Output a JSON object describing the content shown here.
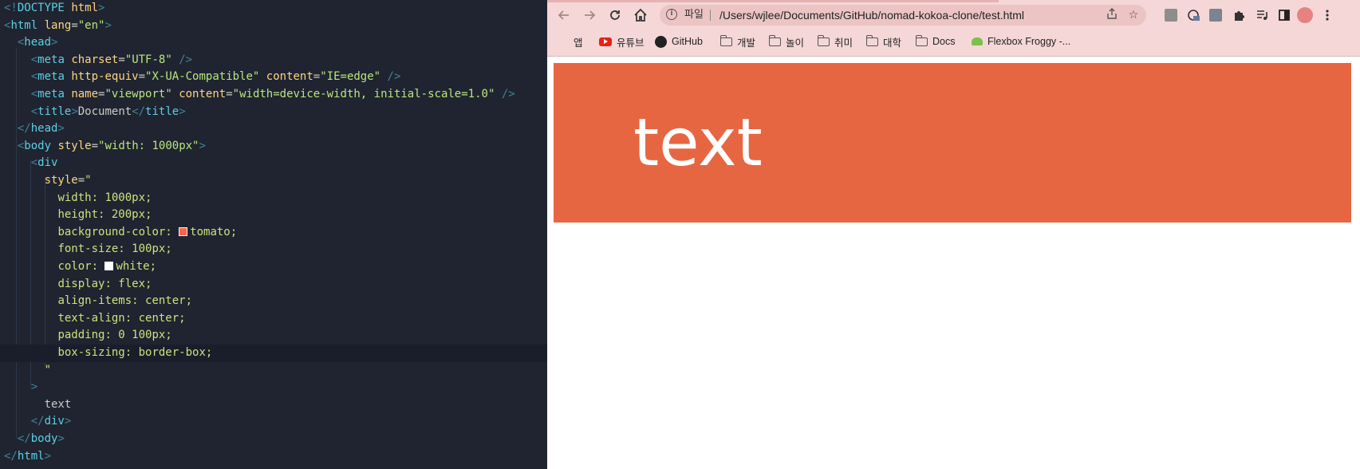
{
  "editor": {
    "lines": [
      [
        [
          "punc",
          "<!"
        ],
        [
          "doctype",
          "DOCTYPE"
        ],
        [
          "txt",
          " "
        ],
        [
          "attr",
          "html"
        ],
        [
          "punc",
          ">"
        ]
      ],
      [
        [
          "punc",
          "<"
        ],
        [
          "tag",
          "html"
        ],
        [
          "txt",
          " "
        ],
        [
          "attr",
          "lang"
        ],
        [
          "txt",
          "="
        ],
        [
          "str",
          "\"en\""
        ],
        [
          "punc",
          ">"
        ]
      ],
      [
        [
          "txt",
          "  "
        ],
        [
          "punc",
          "<"
        ],
        [
          "tag",
          "head"
        ],
        [
          "punc",
          ">"
        ]
      ],
      [
        [
          "txt",
          "    "
        ],
        [
          "punc",
          "<"
        ],
        [
          "tag",
          "meta"
        ],
        [
          "txt",
          " "
        ],
        [
          "attr",
          "charset"
        ],
        [
          "txt",
          "="
        ],
        [
          "str",
          "\"UTF-8\""
        ],
        [
          "txt",
          " "
        ],
        [
          "punc",
          "/>"
        ]
      ],
      [
        [
          "txt",
          "    "
        ],
        [
          "punc",
          "<"
        ],
        [
          "tag",
          "meta"
        ],
        [
          "txt",
          " "
        ],
        [
          "attr",
          "http-equiv"
        ],
        [
          "txt",
          "="
        ],
        [
          "str",
          "\"X-UA-Compatible\""
        ],
        [
          "txt",
          " "
        ],
        [
          "attr",
          "content"
        ],
        [
          "txt",
          "="
        ],
        [
          "str",
          "\"IE=edge\""
        ],
        [
          "txt",
          " "
        ],
        [
          "punc",
          "/>"
        ]
      ],
      [
        [
          "txt",
          "    "
        ],
        [
          "punc",
          "<"
        ],
        [
          "tag",
          "meta"
        ],
        [
          "txt",
          " "
        ],
        [
          "attr",
          "name"
        ],
        [
          "txt",
          "="
        ],
        [
          "str",
          "\"viewport\""
        ],
        [
          "txt",
          " "
        ],
        [
          "attr",
          "content"
        ],
        [
          "txt",
          "="
        ],
        [
          "str",
          "\"width=device-width, initial-scale=1.0\""
        ],
        [
          "txt",
          " "
        ],
        [
          "punc",
          "/>"
        ]
      ],
      [
        [
          "txt",
          "    "
        ],
        [
          "punc",
          "<"
        ],
        [
          "tag",
          "title"
        ],
        [
          "punc",
          ">"
        ],
        [
          "txt",
          "Document"
        ],
        [
          "punc",
          "</"
        ],
        [
          "tag",
          "title"
        ],
        [
          "punc",
          ">"
        ]
      ],
      [
        [
          "txt",
          "  "
        ],
        [
          "punc",
          "</"
        ],
        [
          "tag",
          "head"
        ],
        [
          "punc",
          ">"
        ]
      ],
      [
        [
          "txt",
          "  "
        ],
        [
          "punc",
          "<"
        ],
        [
          "tag",
          "body"
        ],
        [
          "txt",
          " "
        ],
        [
          "attr",
          "style"
        ],
        [
          "txt",
          "="
        ],
        [
          "str",
          "\"width: 1000px\""
        ],
        [
          "punc",
          ">"
        ]
      ],
      [
        [
          "txt",
          "    "
        ],
        [
          "punc",
          "<"
        ],
        [
          "tag",
          "div"
        ]
      ],
      [
        [
          "txt",
          "      "
        ],
        [
          "attr",
          "style"
        ],
        [
          "txt",
          "="
        ],
        [
          "str",
          "\""
        ]
      ],
      [
        [
          "txt",
          "        "
        ],
        [
          "css",
          "width: 1000px;"
        ]
      ],
      [
        [
          "txt",
          "        "
        ],
        [
          "css",
          "height: 200px;"
        ]
      ],
      [
        [
          "txt",
          "        "
        ],
        [
          "css",
          "background-color: "
        ],
        [
          "swatch",
          "#ff6347"
        ],
        [
          "css",
          "tomato;"
        ]
      ],
      [
        [
          "txt",
          "        "
        ],
        [
          "css",
          "font-size: 100px;"
        ]
      ],
      [
        [
          "txt",
          "        "
        ],
        [
          "css",
          "color: "
        ],
        [
          "swatch",
          "#ffffff"
        ],
        [
          "css",
          "white;"
        ]
      ],
      [
        [
          "txt",
          "        "
        ],
        [
          "css",
          "display: flex;"
        ]
      ],
      [
        [
          "txt",
          "        "
        ],
        [
          "css",
          "align-items: center;"
        ]
      ],
      [
        [
          "txt",
          "        "
        ],
        [
          "css",
          "text-align: center;"
        ]
      ],
      [
        [
          "txt",
          "        "
        ],
        [
          "css",
          "padding: 0 100px;"
        ]
      ],
      [
        [
          "txt",
          "        "
        ],
        [
          "css",
          "box-sizing: border-box;"
        ]
      ],
      [
        [
          "txt",
          "      "
        ],
        [
          "str",
          "\""
        ]
      ],
      [
        [
          "txt",
          "    "
        ],
        [
          "punc",
          ">"
        ]
      ],
      [
        [
          "txt",
          "      "
        ],
        [
          "txt",
          "text"
        ]
      ],
      [
        [
          "txt",
          "    "
        ],
        [
          "punc",
          "</"
        ],
        [
          "tag",
          "div"
        ],
        [
          "punc",
          ">"
        ]
      ],
      [
        [
          "txt",
          "  "
        ],
        [
          "punc",
          "</"
        ],
        [
          "tag",
          "body"
        ],
        [
          "punc",
          ">"
        ]
      ],
      [
        [
          "punc",
          "</"
        ],
        [
          "tag",
          "html"
        ],
        [
          "punc",
          ">"
        ]
      ]
    ],
    "active_line": 20
  },
  "browser": {
    "back_icon": "arrow-left-icon",
    "forward_icon": "arrow-right-icon",
    "reload_icon": "reload-icon",
    "home_icon": "home-icon",
    "address_scheme": "파일",
    "address_url": "/Users/wjlee/Documents/GitHub/nomad-kokoa-clone/test.html",
    "bookmarks": [
      {
        "label": "앱",
        "icon": "apps-grid-icon"
      },
      {
        "label": "유튜브",
        "icon": "youtube-icon"
      },
      {
        "label": "GitHub",
        "icon": "github-icon"
      },
      {
        "label": "개발",
        "icon": "folder-icon"
      },
      {
        "label": "놀이",
        "icon": "folder-icon"
      },
      {
        "label": "취미",
        "icon": "folder-icon"
      },
      {
        "label": "대학",
        "icon": "folder-icon"
      },
      {
        "label": "Docs",
        "icon": "folder-icon"
      },
      {
        "label": "Flexbox Froggy -...",
        "icon": "android-icon"
      }
    ]
  },
  "page": {
    "box_text": "text",
    "box_color": "#e76642",
    "text_color": "#ffffff"
  }
}
